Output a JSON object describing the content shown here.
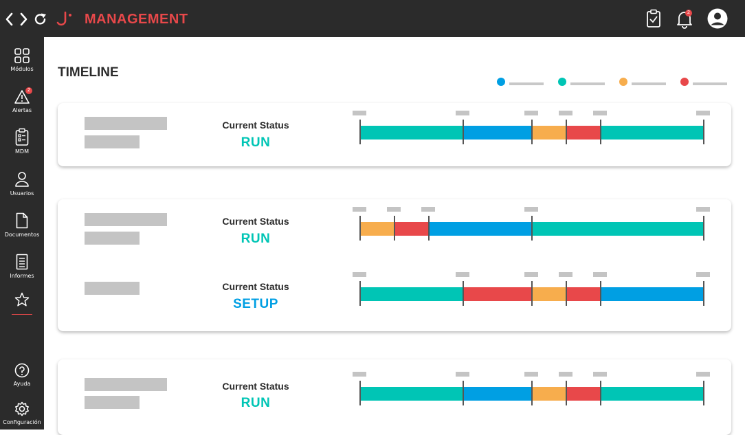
{
  "app": {
    "brand": "MANAGEMENT",
    "notification_count": "2"
  },
  "colors": {
    "run": "#00c5b5",
    "setup": "#009fe3",
    "warning": "#f7ad4d",
    "stop": "#e8484a",
    "dark": "#2b2b2b"
  },
  "sidebar": {
    "items": [
      {
        "label": "Módulos",
        "icon": "grid-icon"
      },
      {
        "label": "Alertas",
        "icon": "warning-icon",
        "badge": "2"
      },
      {
        "label": "MDM",
        "icon": "clipboard-list-icon"
      },
      {
        "label": "Usuarios",
        "icon": "user-icon"
      },
      {
        "label": "Documentos",
        "icon": "document-icon"
      },
      {
        "label": "Informes",
        "icon": "report-icon"
      },
      {
        "label": "",
        "icon": "star-icon"
      },
      {
        "label": "Ayuda",
        "icon": "help-icon"
      },
      {
        "label": "Configuración",
        "icon": "gear-icon"
      }
    ]
  },
  "page": {
    "title": "TIMELINE"
  },
  "legend": [
    {
      "color": "#009fe3"
    },
    {
      "color": "#00c5b5"
    },
    {
      "color": "#f7ad4d"
    },
    {
      "color": "#e8484a"
    }
  ],
  "machines": [
    {
      "status_label": "Current Status",
      "status": "RUN",
      "segments": [
        {
          "state": "run",
          "fraction": 0.3
        },
        {
          "state": "setup",
          "fraction": 0.2
        },
        {
          "state": "warning",
          "fraction": 0.1
        },
        {
          "state": "stop",
          "fraction": 0.1
        },
        {
          "state": "run",
          "fraction": 0.3
        }
      ]
    },
    {
      "status_label": "Current Status",
      "status": "RUN",
      "segments": [
        {
          "state": "warning",
          "fraction": 0.1
        },
        {
          "state": "stop",
          "fraction": 0.1
        },
        {
          "state": "setup",
          "fraction": 0.3
        },
        {
          "state": "run",
          "fraction": 0.5
        }
      ]
    },
    {
      "status_label": "Current Status",
      "status": "SETUP",
      "segments": [
        {
          "state": "run",
          "fraction": 0.3
        },
        {
          "state": "stop",
          "fraction": 0.2
        },
        {
          "state": "warning",
          "fraction": 0.1
        },
        {
          "state": "stop",
          "fraction": 0.1
        },
        {
          "state": "setup",
          "fraction": 0.3
        }
      ]
    },
    {
      "status_label": "Current Status",
      "status": "RUN",
      "segments": [
        {
          "state": "run",
          "fraction": 0.3
        },
        {
          "state": "setup",
          "fraction": 0.2
        },
        {
          "state": "warning",
          "fraction": 0.1
        },
        {
          "state": "stop",
          "fraction": 0.1
        },
        {
          "state": "run",
          "fraction": 0.3
        }
      ]
    }
  ]
}
